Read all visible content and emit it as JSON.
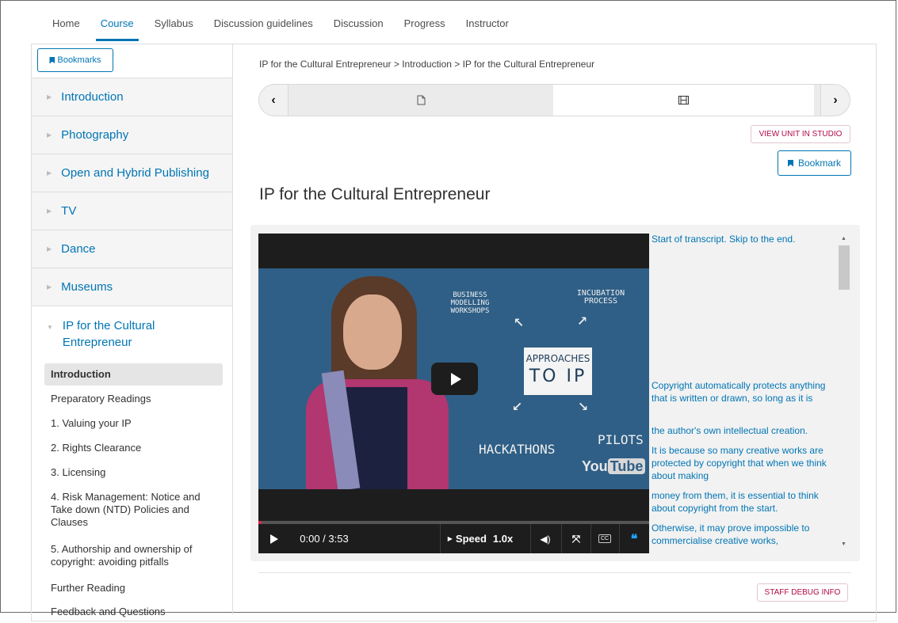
{
  "nav": {
    "tabs": [
      "Home",
      "Course",
      "Syllabus",
      "Discussion guidelines",
      "Discussion",
      "Progress",
      "Instructor"
    ],
    "active_tab": "Course"
  },
  "sidebar": {
    "bookmarks_label": "Bookmarks",
    "chapters": [
      "Introduction",
      "Photography",
      "Open and Hybrid Publishing",
      "TV",
      "Dance",
      "Museums"
    ],
    "open_chapter": "IP for the Cultural Entrepreneur",
    "subsections": [
      "Introduction",
      "Preparatory Readings",
      "1. Valuing your IP",
      "2. Rights Clearance",
      "3. Licensing",
      "4. Risk Management: Notice and Take down (NTD) Policies and Clauses",
      "5. Authorship and ownership of copyright: avoiding pitfalls",
      "Further Reading",
      "Feedback and Questions"
    ]
  },
  "breadcrumb": "IP for the Cultural Entrepreneur > Introduction > IP for the Cultural Entrepreneur",
  "sequence": {
    "prev_icon": "chevron-left-icon",
    "next_icon": "chevron-right-icon",
    "tab1_icon": "document-icon",
    "tab2_icon": "video-icon"
  },
  "studio_button": "VIEW UNIT IN STUDIO",
  "bookmark_button": "Bookmark",
  "unit_title": "IP for the Cultural Entrepreneur",
  "video": {
    "chalk": {
      "business": "BUSINESS\nMODELLING\nWORKSHOPS",
      "incubation": "INCUBATION\nPROCESS",
      "approaches": "APPROACHES",
      "to_ip": "TO IP",
      "hackathons": "HACKATHONS",
      "pilots": "PILOTS"
    },
    "youtube": {
      "you": "You",
      "tube": "Tube"
    },
    "time": "0:00 / 3:53",
    "speed_label": "Speed",
    "speed_value": "1.0x"
  },
  "transcript": {
    "start": "Start of transcript. Skip to the end.",
    "lines": [
      "Copyright automatically protects anything that is written or drawn, so long as it is",
      "the author's own intellectual creation.",
      "It is because so many creative works are protected by copyright that when we think about making",
      "money from them, it is essential to think about copyright from the start.",
      "Otherwise, it may prove impossible to commercialise creative works,"
    ]
  },
  "debug_button": "STAFF DEBUG INFO",
  "colors": {
    "accent": "#0075b4",
    "studio": "#b20a4a"
  }
}
